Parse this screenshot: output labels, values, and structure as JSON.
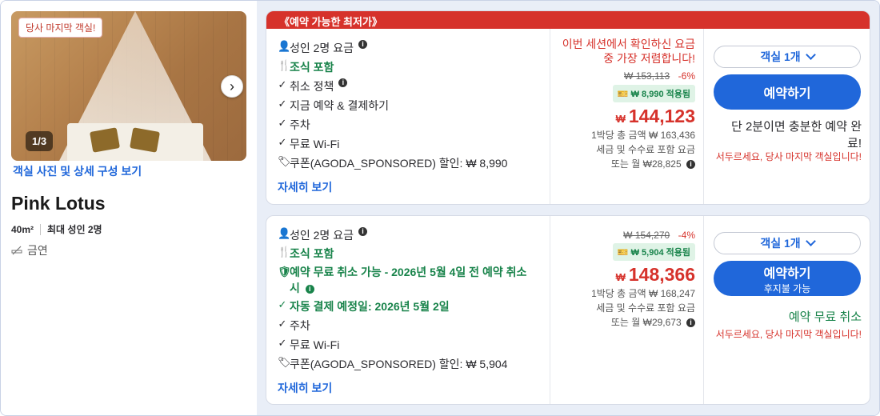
{
  "room": {
    "badge": "당사 마지막 객실!",
    "photo_counter": "1/3",
    "photo_link": "객실 사진 및 상세 구성 보기",
    "name": "Pink Lotus",
    "size": "40m²",
    "max_occupancy": "최대 성인 2명",
    "smoking": "금연"
  },
  "offers": [
    {
      "banner": "《예약 가능한 최저가》",
      "features": [
        {
          "icon": "person-icon",
          "text": "성인 2명 요금",
          "info": true
        },
        {
          "icon": "utensils-icon",
          "text": "조식 포함",
          "green": true
        },
        {
          "icon": "check-icon",
          "text": "취소 정책",
          "info": true
        },
        {
          "icon": "check-icon",
          "text": "지금 예약 & 결제하기"
        },
        {
          "icon": "check-icon",
          "text": "주차"
        },
        {
          "icon": "check-icon",
          "text": "무료 Wi-Fi"
        },
        {
          "icon": "tag-icon",
          "text": "쿠폰(AGODA_SPONSORED) 할인: ₩ 8,990"
        }
      ],
      "more_link": "자세히 보기",
      "urgency": "이번 세션에서 확인하신 요금 중 가장 저렴합니다!",
      "original_price": "₩ 153,113",
      "discount": "-6%",
      "coupon_applied": "₩ 8,990 적용됨",
      "currency": "₩",
      "price": "144,123",
      "total_line": "1박당 총 금액 ₩ 163,436",
      "tax_line": "세금 및 수수료 포함 요금",
      "monthly_line": "또는 월 ₩28,825",
      "rooms_select": "객실 1개",
      "book_label": "예약하기",
      "book_sub": "",
      "note_main": "단 2분이면 충분한 예약 완료!",
      "note_warning": "서두르세요, 당사 마지막 객실입니다!"
    },
    {
      "features": [
        {
          "icon": "person-icon",
          "text": "성인 2명 요금",
          "info": true
        },
        {
          "icon": "utensils-icon",
          "text": "조식 포함",
          "green": true
        },
        {
          "icon": "shield-check-icon",
          "text": "예약 무료 취소 가능 - 2026년 5월 4일 전 예약 취소 시",
          "green": true,
          "info": true
        },
        {
          "icon": "check-icon",
          "text": "자동 결제 예정일: 2026년 5월 2일",
          "green": true
        },
        {
          "icon": "check-icon",
          "text": "주차"
        },
        {
          "icon": "check-icon",
          "text": "무료 Wi-Fi"
        },
        {
          "icon": "tag-icon",
          "text": "쿠폰(AGODA_SPONSORED) 할인: ₩ 5,904"
        }
      ],
      "more_link": "자세히 보기",
      "original_price": "₩ 154,270",
      "discount": "-4%",
      "coupon_applied": "₩ 5,904 적용됨",
      "currency": "₩",
      "price": "148,366",
      "total_line": "1박당 총 금액 ₩ 168,247",
      "tax_line": "세금 및 수수료 포함 요금",
      "monthly_line": "또는 월 ₩29,673",
      "rooms_select": "객실 1개",
      "book_label": "예약하기",
      "book_sub": "후지불 가능",
      "note_main": "예약 무료 취소",
      "note_warning": "서두르세요, 당사 마지막 객실입니다!"
    }
  ]
}
